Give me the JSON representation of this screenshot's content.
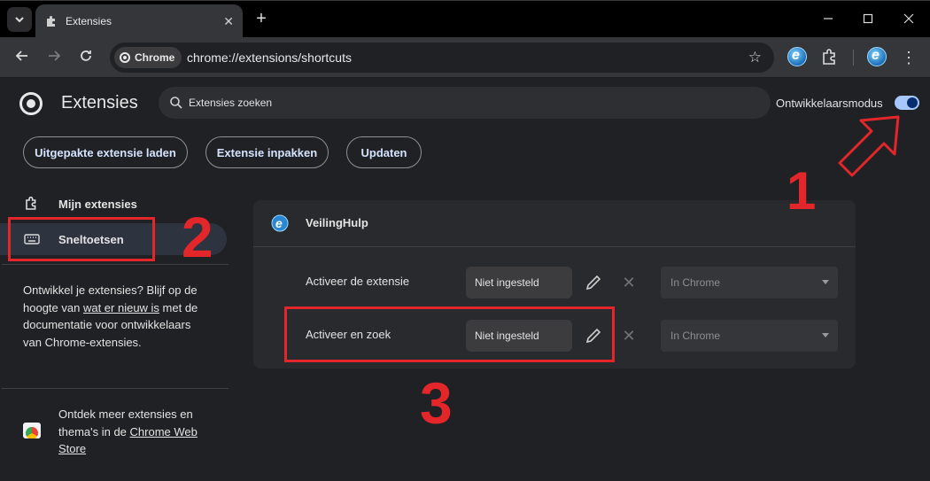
{
  "browser": {
    "tab_title": "Extensies",
    "url_chip": "Chrome",
    "url": "chrome://extensions/shortcuts"
  },
  "page": {
    "title": "Extensies",
    "search_placeholder": "Extensies zoeken",
    "dev_mode_label": "Ontwikkelaarsmodus",
    "dev_mode_on": true
  },
  "actions": {
    "load_unpacked": "Uitgepakte extensie laden",
    "pack": "Extensie inpakken",
    "update": "Updaten"
  },
  "sidebar": {
    "items": [
      {
        "label": "Mijn extensies",
        "icon": "puzzle-icon"
      },
      {
        "label": "Sneltoetsen",
        "icon": "keyboard-icon",
        "active": true
      }
    ],
    "dev_text_1": "Ontwikkel je extensies? Blijf op de hoogte van ",
    "dev_link": "wat er nieuw is",
    "dev_text_2": " met de documentatie voor ontwikkelaars van Chrome-extensies.",
    "store_text": "Ontdek meer extensies en thema's in de ",
    "store_link": "Chrome Web Store"
  },
  "card": {
    "extension_name": "VeilingHulp",
    "rows": [
      {
        "label": "Activeer de extensie",
        "shortcut": "Niet ingesteld",
        "scope": "In Chrome"
      },
      {
        "label": "Activeer en zoek",
        "shortcut": "Niet ingesteld",
        "scope": "In Chrome"
      }
    ]
  },
  "annotations": {
    "num1": "1",
    "num2": "2",
    "num3": "3",
    "color": "#e3262a"
  }
}
